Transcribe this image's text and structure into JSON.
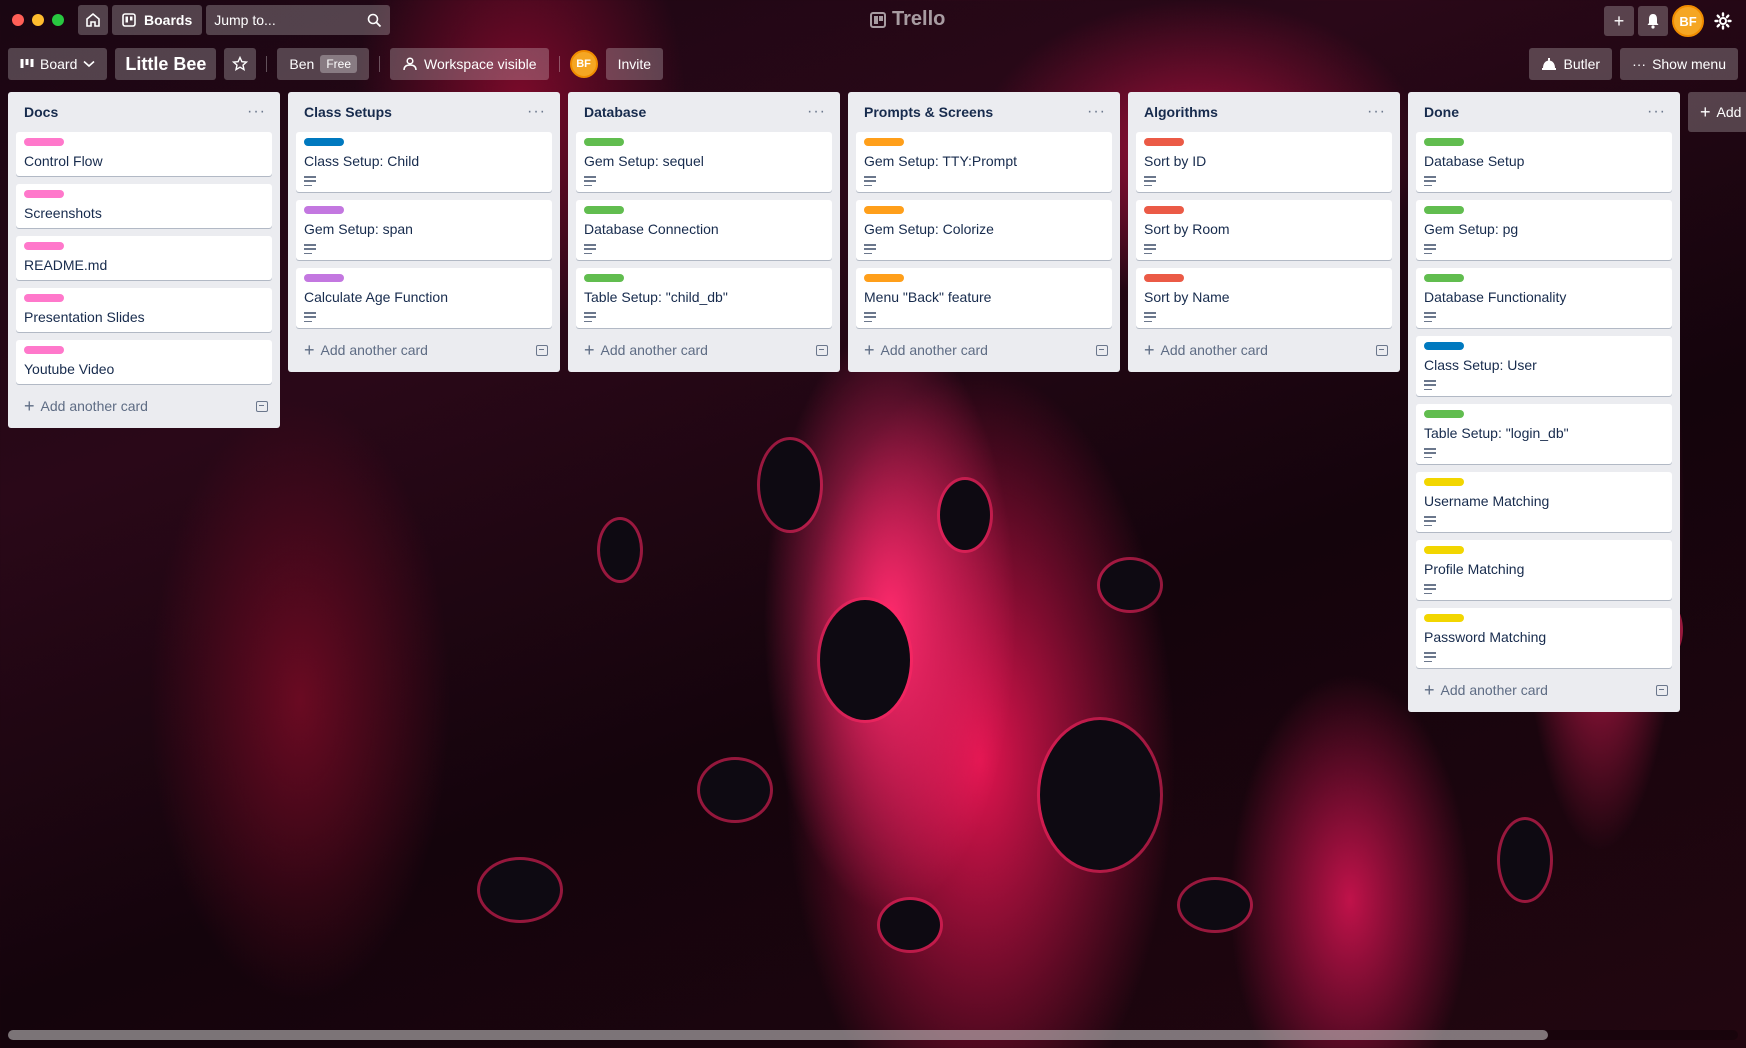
{
  "topbar": {
    "boards_label": "Boards",
    "search_placeholder": "Jump to...",
    "logo_text": "Trello",
    "avatar_initials": "BF"
  },
  "board": {
    "view_label": "Board",
    "title": "Little Bee",
    "workspace_name": "Ben",
    "plan_badge": "Free",
    "visibility_label": "Workspace visible",
    "member_initials": "BF",
    "invite_label": "Invite",
    "butler_label": "Butler",
    "show_menu_label": "Show menu"
  },
  "colors": {
    "pink": "#ff78cb",
    "blue": "#0079bf",
    "purple": "#c377e0",
    "green": "#61bd4f",
    "orange": "#ff9f1a",
    "red": "#eb5a46",
    "yellow": "#f2d600"
  },
  "add_card_label": "Add another card",
  "add_list_label": "Add",
  "lists": [
    {
      "title": "Docs",
      "cards": [
        {
          "title": "Control Flow",
          "label": "pink",
          "has_desc": false
        },
        {
          "title": "Screenshots",
          "label": "pink",
          "has_desc": false
        },
        {
          "title": "README.md",
          "label": "pink",
          "has_desc": false
        },
        {
          "title": "Presentation Slides",
          "label": "pink",
          "has_desc": false
        },
        {
          "title": "Youtube Video",
          "label": "pink",
          "has_desc": false
        }
      ]
    },
    {
      "title": "Class Setups",
      "cards": [
        {
          "title": "Class Setup: Child",
          "label": "blue",
          "has_desc": true
        },
        {
          "title": "Gem Setup: span",
          "label": "purple",
          "has_desc": true
        },
        {
          "title": "Calculate Age Function",
          "label": "purple",
          "has_desc": true
        }
      ]
    },
    {
      "title": "Database",
      "cards": [
        {
          "title": "Gem Setup: sequel",
          "label": "green",
          "has_desc": true
        },
        {
          "title": "Database Connection",
          "label": "green",
          "has_desc": true
        },
        {
          "title": "Table Setup: \"child_db\"",
          "label": "green",
          "has_desc": true
        }
      ]
    },
    {
      "title": "Prompts & Screens",
      "cards": [
        {
          "title": "Gem Setup: TTY:Prompt",
          "label": "orange",
          "has_desc": true
        },
        {
          "title": "Gem Setup: Colorize",
          "label": "orange",
          "has_desc": true
        },
        {
          "title": "Menu \"Back\" feature",
          "label": "orange",
          "has_desc": true
        }
      ]
    },
    {
      "title": "Algorithms",
      "cards": [
        {
          "title": "Sort by ID",
          "label": "red",
          "has_desc": true
        },
        {
          "title": "Sort by Room",
          "label": "red",
          "has_desc": true
        },
        {
          "title": "Sort by Name",
          "label": "red",
          "has_desc": true
        }
      ]
    },
    {
      "title": "Done",
      "cards": [
        {
          "title": "Database Setup",
          "label": "green",
          "has_desc": true
        },
        {
          "title": "Gem Setup: pg",
          "label": "green",
          "has_desc": true
        },
        {
          "title": "Database Functionality",
          "label": "green",
          "has_desc": true
        },
        {
          "title": "Class Setup: User",
          "label": "blue",
          "has_desc": true
        },
        {
          "title": "Table Setup: \"login_db\"",
          "label": "green",
          "has_desc": true
        },
        {
          "title": "Username Matching",
          "label": "yellow",
          "has_desc": true
        },
        {
          "title": "Profile Matching",
          "label": "yellow",
          "has_desc": true
        },
        {
          "title": "Password Matching",
          "label": "yellow",
          "has_desc": true
        }
      ]
    }
  ]
}
